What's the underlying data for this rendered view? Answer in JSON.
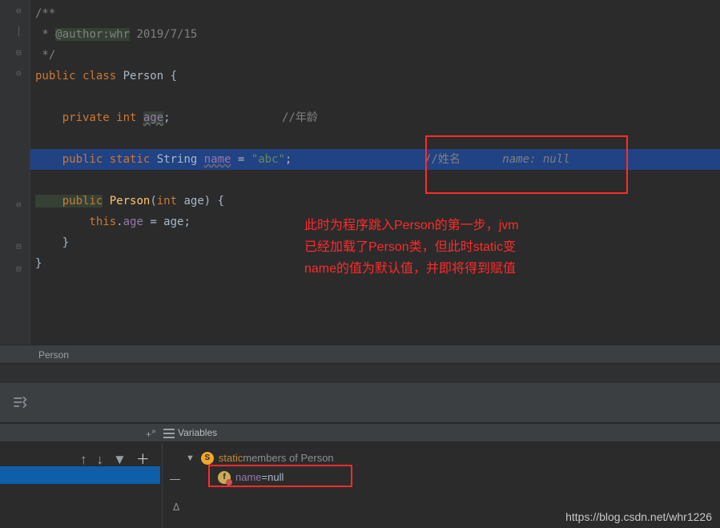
{
  "code": {
    "l1a": "/**",
    "l2a": " * ",
    "l2b": "@author:whr",
    "l2c": " 2019/7/15",
    "l3a": " */",
    "l4_kw1": "public ",
    "l4_kw2": "class ",
    "l4_name": "Person {",
    "l6_kw1": "    private ",
    "l6_kw2": "int ",
    "l6_field": "age",
    "l6_sc": ";",
    "l6_comment": "//年龄",
    "l8_kw1": "    public ",
    "l8_kw2": "static ",
    "l8_type": "String ",
    "l8_field": "name",
    "l8_assign": " = ",
    "l8_str": "\"abc\"",
    "l8_sc": ";",
    "l8_comment": "//姓名",
    "l8_hint": "   name: null",
    "l10_kw": "    public",
    "l10_sig": " Person",
    "l10_paren1": "(",
    "l10_kw2": "int ",
    "l10_arg": "age) {",
    "l11_this": "        this",
    "l11_dot": ".",
    "l11_field": "age",
    "l11_assign": " = age;",
    "l12": "    }",
    "l13": "}"
  },
  "breadcrumb": {
    "current": "Person"
  },
  "annot": {
    "line1": "此时为程序跳入Person的第一步，jvm",
    "line2": "已经加载了Person类，但此时static变",
    "line3": "name的值为默认值，并即将得到赋值"
  },
  "vars": {
    "title": "Variables",
    "row1_kw": "static",
    "row1_rest": " members of Person",
    "row2_name": "name",
    "row2_eq": " = ",
    "row2_val": "null"
  },
  "watermark": "https://blog.csdn.net/whr1226"
}
